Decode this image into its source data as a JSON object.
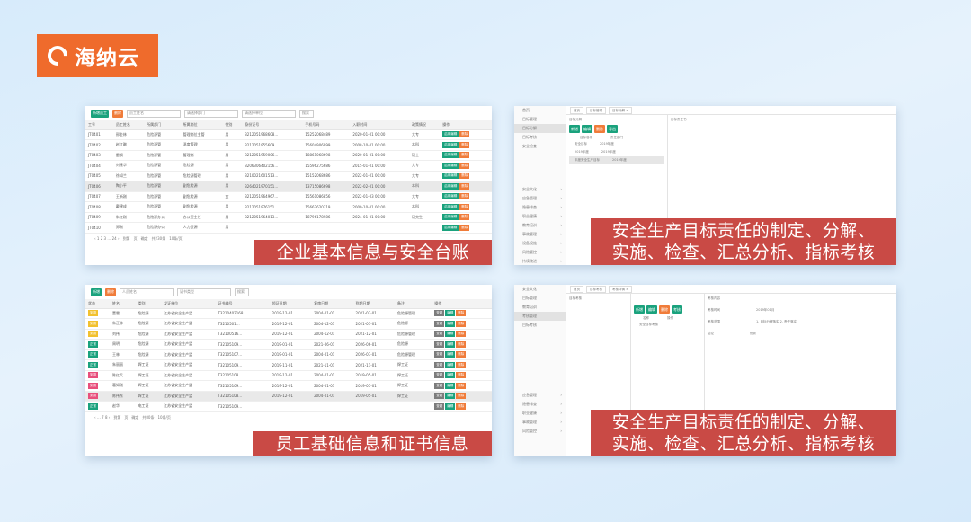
{
  "logo": {
    "text": "海纳云"
  },
  "captions": [
    "企业基本信息与安全台账",
    "安全生产目标责任的制定、分解、\n实施、检查、汇总分析、指标考核",
    "员工基础信息和证书信息",
    "安全生产目标责任的制定、分解、\n实施、检查、汇总分析、指标考核"
  ],
  "colors": {
    "accent": "#ef6b2c",
    "caption_bg": "#c94a45",
    "green": "#1aa27d"
  },
  "shot1": {
    "toolbar": {
      "add": "新增员工",
      "del": "删除",
      "name_ph": "员工姓名",
      "dept_ph": "请选择部门",
      "company_ph": "请选择单位",
      "search": "搜索"
    },
    "columns": [
      "工号",
      "员工姓名",
      "所属部门",
      "所属岗位",
      "性别",
      "身份证号",
      "手机号码",
      "入职时间",
      "政策情况",
      "操作"
    ],
    "rows": [
      [
        "JT0401",
        "邢金林",
        "危险源管",
        "管理岗位主管",
        "男",
        "3212051968608…",
        "15252068489",
        "2020-01-01 00:00",
        "大专"
      ],
      [
        "JT0402",
        "赵红琳",
        "危险源管",
        "温度管理",
        "男",
        "3212051955609…",
        "15604906999",
        "2008-10-01 00:00",
        "本科"
      ],
      [
        "JT0403",
        "雷钢",
        "危险源管",
        "管理岗",
        "男",
        "3212051959006…",
        "18861068698",
        "2020-01-01 00:00",
        "硕士"
      ],
      [
        "JT0404",
        "刘建华",
        "危险源管",
        "危险源",
        "男",
        "3206306402156…",
        "15596275686",
        "2015-01-01 00:00",
        "大专"
      ],
      [
        "JT0405",
        "徐如兰",
        "危险源管",
        "危险源管理",
        "男",
        "3210021601513…",
        "15152068686",
        "2022-01-01 00:00",
        "大专"
      ],
      [
        "JT0406",
        "陶小平",
        "危险源管",
        "副危险源",
        "男",
        "3264021970151…",
        "13715086698",
        "2022-02-01 00:00",
        "本科"
      ],
      [
        "JT0407",
        "王新刚",
        "危险源管",
        "副危险源",
        "女",
        "3212051964967…",
        "15561086856",
        "2022-01-03 00:00",
        "大专"
      ],
      [
        "JT0408",
        "戴建成",
        "危险源管",
        "副危险源",
        "男",
        "3212051976151…",
        "15662620319",
        "2009-10-01 00:00",
        "本科"
      ],
      [
        "JT0409",
        "朱红刚",
        "危险源办公",
        "办公室主任",
        "男",
        "3212051964013…",
        "18796178986",
        "2024-01-01 00:00",
        "研究生"
      ],
      [
        "JT0410",
        "郑刚",
        "危险源办公",
        "人力资源",
        "男",
        "",
        "",
        "",
        ""
      ]
    ],
    "ops": [
      "启用编辑",
      "删除"
    ],
    "pager": {
      "pages": "‹ 1 2 3 … 24 ›",
      "goto": "到第",
      "page": "页",
      "confirm": "确定",
      "total": "共230条",
      "per": "10条/页"
    }
  },
  "shot2": {
    "tabs": [
      "首页",
      "目标管理",
      "目标分解 ×"
    ],
    "menu": [
      "首页",
      "目标管理",
      "目标分解",
      "目标考核",
      "安全检查"
    ],
    "menu_lower": [
      "安全文化",
      "应急管理",
      "隐患排查",
      "职业健康",
      "教育培训",
      "事故管理",
      "设备设施",
      "风险管控",
      "持续改进"
    ],
    "panel_title": "目标分解",
    "panel_title2": "目标责任书",
    "btns": [
      "新增",
      "编辑",
      "删除",
      "导出"
    ],
    "tree_cols": [
      "目标名称",
      "责任部门"
    ],
    "tree": [
      [
        "安全目标",
        "2019年度"
      ],
      [
        "2019年度",
        "2019年度"
      ],
      [
        "年度安全生产目标",
        "2019年度"
      ]
    ]
  },
  "shot3": {
    "toolbar": {
      "add": "新增",
      "del": "删除",
      "name_ph": "人员姓名",
      "cert_ph": "证书类型",
      "search": "搜索"
    },
    "columns": [
      "状态",
      "姓名",
      "类别",
      "发证单位",
      "证书编号",
      "领证日期",
      "复审日期",
      "到期日期",
      "备注",
      "操作"
    ],
    "rows": [
      [
        "到期",
        "董雪",
        "危险源",
        "江苏省安全生产监",
        "T3210402168…",
        "2019-12-01",
        "2004-01-01",
        "2021-07-01",
        "危险源管理"
      ],
      [
        "到期",
        "朱正林",
        "危险源",
        "江苏省安全生产监",
        "T3210501…",
        "2019-12-01",
        "2004-12-01",
        "2021-07-01",
        "危险源"
      ],
      [
        "到期",
        "刘伟",
        "危险源",
        "江苏省安全生产监",
        "T32100516…",
        "2019-12-01",
        "2004-12-01",
        "2021-12-01",
        "危险源管理"
      ],
      [
        "正常",
        "周明",
        "危险源",
        "江苏省安全生产监",
        "T32105109…",
        "2019-01-01",
        "2021-06-01",
        "2026-06-01",
        "危险源"
      ],
      [
        "正常",
        "王林",
        "危险源",
        "江苏省安全生产监",
        "T32105107…",
        "2019-01-01",
        "2004-01-01",
        "2026-07-01",
        "危险源管理"
      ],
      [
        "正常",
        "朱丽丽",
        "焊工证",
        "江苏省安全生产监",
        "T32105109…",
        "2019-11-01",
        "2021-11-01",
        "2021-11-01",
        "焊工证"
      ],
      [
        "到期",
        "陈红兵",
        "焊工证",
        "江苏省安全生产监",
        "T32105108…",
        "2019-12-01",
        "2004-01-01",
        "2019-05-01",
        "焊工证"
      ],
      [
        "到期",
        "葛如刚",
        "焊工证",
        "江苏省安全生产监",
        "T32105109…",
        "2019-12-01",
        "2004-01-01",
        "2019-05-01",
        "焊工证"
      ],
      [
        "到期",
        "陈伟东",
        "焊工证",
        "江苏省安全生产监",
        "T32105108…",
        "2019-12-01",
        "2004-01-01",
        "2019-05-01",
        "焊工证"
      ],
      [
        "正常",
        "赵华",
        "电工证",
        "江苏省安全生产监",
        "T32105109…",
        "",
        "",
        "",
        ""
      ]
    ],
    "ops": [
      "查看",
      "编辑",
      "删除"
    ],
    "pager": {
      "pages": "‹ … 7 8 ›",
      "goto": "到第",
      "page": "页",
      "confirm": "确定",
      "total": "共80条",
      "per": "10条/页"
    }
  },
  "shot4": {
    "tabs": [
      "首页",
      "目标考核",
      "考核详情 ×"
    ],
    "menu": [
      "安全文化",
      "目标管理",
      "教育培训",
      "考核管理",
      "目标考核"
    ],
    "menu_lower": [
      "应急管理",
      "隐患排查",
      "职业健康",
      "事故管理",
      "风险管控"
    ],
    "panel_title": "目标考核",
    "panel_title2": "考核内容",
    "btns": [
      "新增",
      "编辑",
      "删除",
      "考核"
    ],
    "tree_cols": [
      "名称",
      "操作"
    ],
    "tree": [
      [
        "安全目标考核",
        ""
      ]
    ],
    "detail": [
      [
        "考核时间",
        "2019年01月"
      ],
      [
        "考核范围",
        "1. 目标分解落实 2. 责任落实"
      ],
      [
        "结论",
        "优秀"
      ]
    ]
  }
}
